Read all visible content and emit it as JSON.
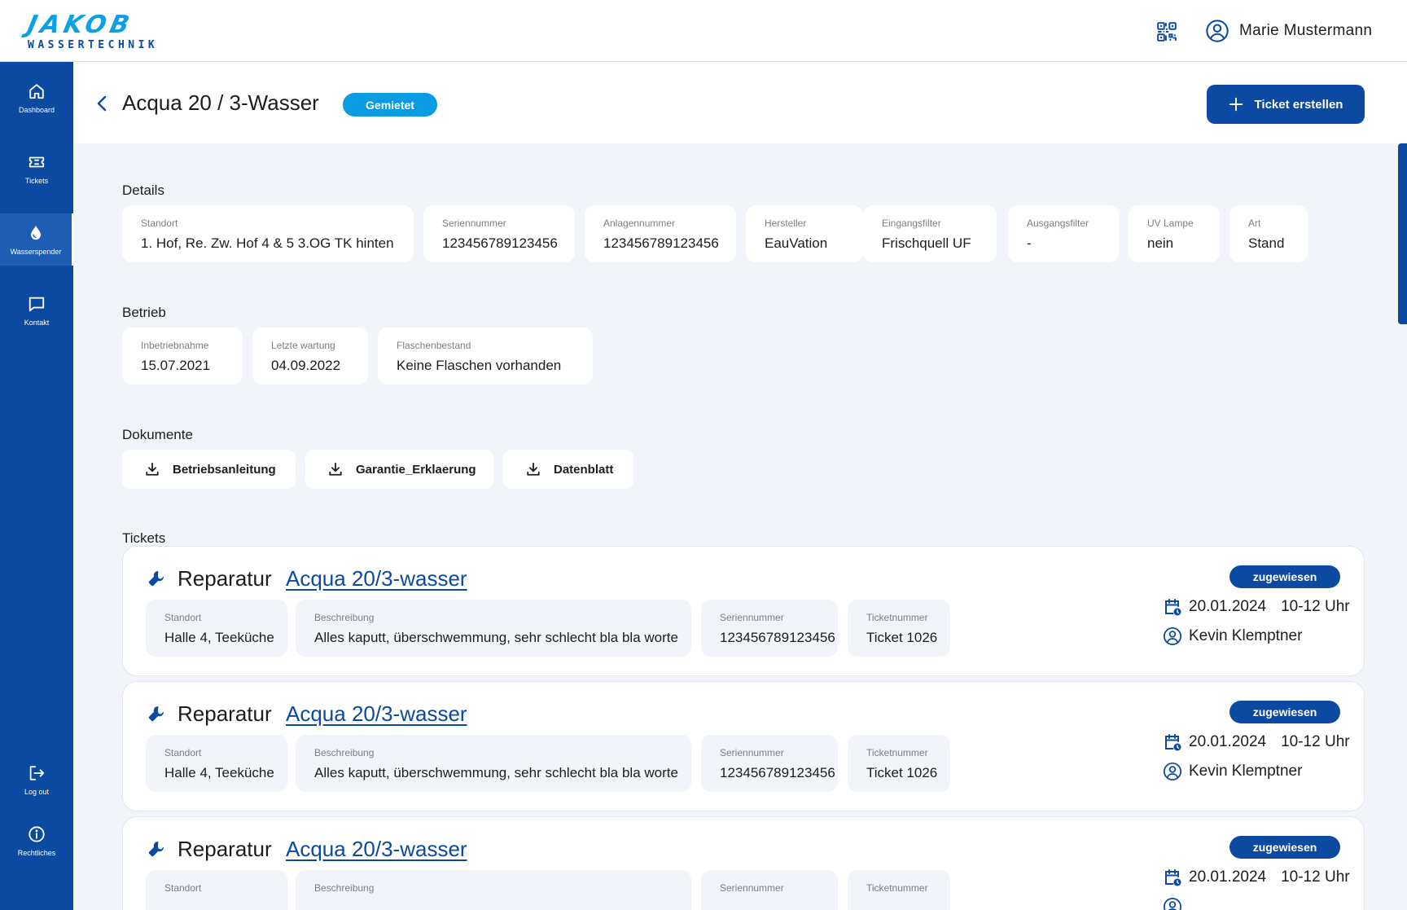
{
  "header": {
    "logo_brand": "JAKOB",
    "logo_sub": "WASSERTECHNIK",
    "user_name": "Marie Mustermann"
  },
  "sidebar": {
    "items": [
      {
        "label": "Dashboard",
        "icon": "home-icon"
      },
      {
        "label": "Tickets",
        "icon": "ticket-icon"
      },
      {
        "label": "Wasserspender",
        "icon": "water-drop-icon",
        "active": true
      },
      {
        "label": "Kontakt",
        "icon": "chat-icon"
      },
      {
        "label": "Log out",
        "icon": "logout-icon"
      },
      {
        "label": "Rechtliches",
        "icon": "info-icon"
      }
    ]
  },
  "page": {
    "title": "Acqua 20 / 3-Wasser",
    "status_badge": "Gemietet",
    "create_ticket_label": "Ticket erstellen"
  },
  "details": {
    "title": "Details",
    "fields": [
      {
        "label": "Standort",
        "value": "1. Hof, Re. Zw. Hof 4 & 5 3.OG TK hinten"
      },
      {
        "label": "Seriennummer",
        "value": "123456789123456"
      },
      {
        "label": "Anlagennummer",
        "value": "123456789123456"
      },
      {
        "label": "Hersteller",
        "value": "EauVation"
      },
      {
        "label": "Eingangsfilter",
        "value": "Frischquell UF"
      },
      {
        "label": "Ausgangsfilter",
        "value": "-"
      },
      {
        "label": "UV Lampe",
        "value": "nein"
      },
      {
        "label": "Art",
        "value": "Stand"
      }
    ]
  },
  "betrieb": {
    "title": "Betrieb",
    "fields": [
      {
        "label": "Inbetriebnahme",
        "value": "15.07.2021"
      },
      {
        "label": "Letzte wartung",
        "value": "04.09.2022"
      },
      {
        "label": "Flaschenbestand",
        "value": "Keine Flaschen vorhanden"
      }
    ]
  },
  "dokumente": {
    "title": "Dokumente",
    "items": [
      "Betriebsanleitung",
      "Garantie_Erklaerung",
      "Datenblatt"
    ]
  },
  "tickets": {
    "title": "Tickets",
    "items": [
      {
        "type": "Reparatur",
        "link": "Acqua 20/3-wasser",
        "status": "zugewiesen",
        "fields": [
          {
            "label": "Standort",
            "value": "Halle 4, Teeküche"
          },
          {
            "label": "Beschreibung",
            "value": "Alles kaputt, überschwemmung, sehr schlecht bla bla worte"
          },
          {
            "label": "Seriennummer",
            "value": "123456789123456"
          },
          {
            "label": "Ticketnummer",
            "value": "Ticket 1026"
          }
        ],
        "date": "20.01.2024",
        "time": "10-12 Uhr",
        "technician": "Kevin Klemptner"
      },
      {
        "type": "Reparatur",
        "link": "Acqua 20/3-wasser",
        "status": "zugewiesen",
        "fields": [
          {
            "label": "Standort",
            "value": "Halle 4, Teeküche"
          },
          {
            "label": "Beschreibung",
            "value": "Alles kaputt, überschwemmung, sehr schlecht bla bla worte"
          },
          {
            "label": "Seriennummer",
            "value": "123456789123456"
          },
          {
            "label": "Ticketnummer",
            "value": "Ticket 1026"
          }
        ],
        "date": "20.01.2024",
        "time": "10-12 Uhr",
        "technician": "Kevin Klemptner"
      },
      {
        "type": "Reparatur",
        "link": "Acqua 20/3-wasser",
        "status": "zugewiesen",
        "fields": [
          {
            "label": "Standort",
            "value": ""
          },
          {
            "label": "Beschreibung",
            "value": ""
          },
          {
            "label": "Seriennummer",
            "value": ""
          },
          {
            "label": "Ticketnummer",
            "value": ""
          }
        ],
        "date": "20.01.2024",
        "time": "10-12 Uhr",
        "technician": ""
      }
    ]
  },
  "colors": {
    "primary": "#0b4aa0",
    "accent": "#0a9be3",
    "background": "#f1f4f8"
  }
}
